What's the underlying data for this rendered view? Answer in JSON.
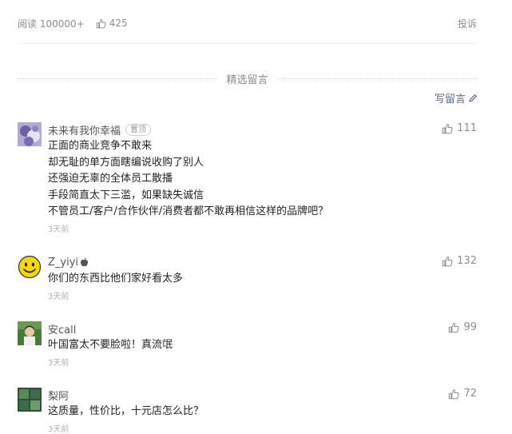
{
  "stats": {
    "views_label": "阅读 100000+",
    "likes": "425",
    "report": "投诉"
  },
  "section": {
    "title": "精选留言",
    "write_label": "写留言"
  },
  "comments": [
    {
      "nickname": "未来有我你幸福",
      "badge": "置顶",
      "likes": "111",
      "lines": [
        "正面的商业竞争不敢来",
        "却无耻的单方面瞎编说收购了别人",
        "还强迫无辜的全体员工散播",
        "手段简直太下三滥，如果缺失诚信",
        "不管员工/客户/合作伙伴/消费者都不敢再相信这样的品牌吧？"
      ],
      "time": "3天前"
    },
    {
      "nickname": "Z_yiyi",
      "likes": "132",
      "lines": [
        "你们的东西比他们家好看太多"
      ],
      "time": "3天前"
    },
    {
      "nickname": "安call",
      "likes": "99",
      "lines": [
        "叶国富太不要脸啦！真流氓"
      ],
      "time": "3天前"
    },
    {
      "nickname": "梨阿",
      "likes": "72",
      "lines": [
        "这质量，性价比，十元店怎么比？"
      ],
      "time": "3天前"
    }
  ],
  "colors": {
    "link": "#576b95",
    "meta": "#8c8c8c"
  }
}
